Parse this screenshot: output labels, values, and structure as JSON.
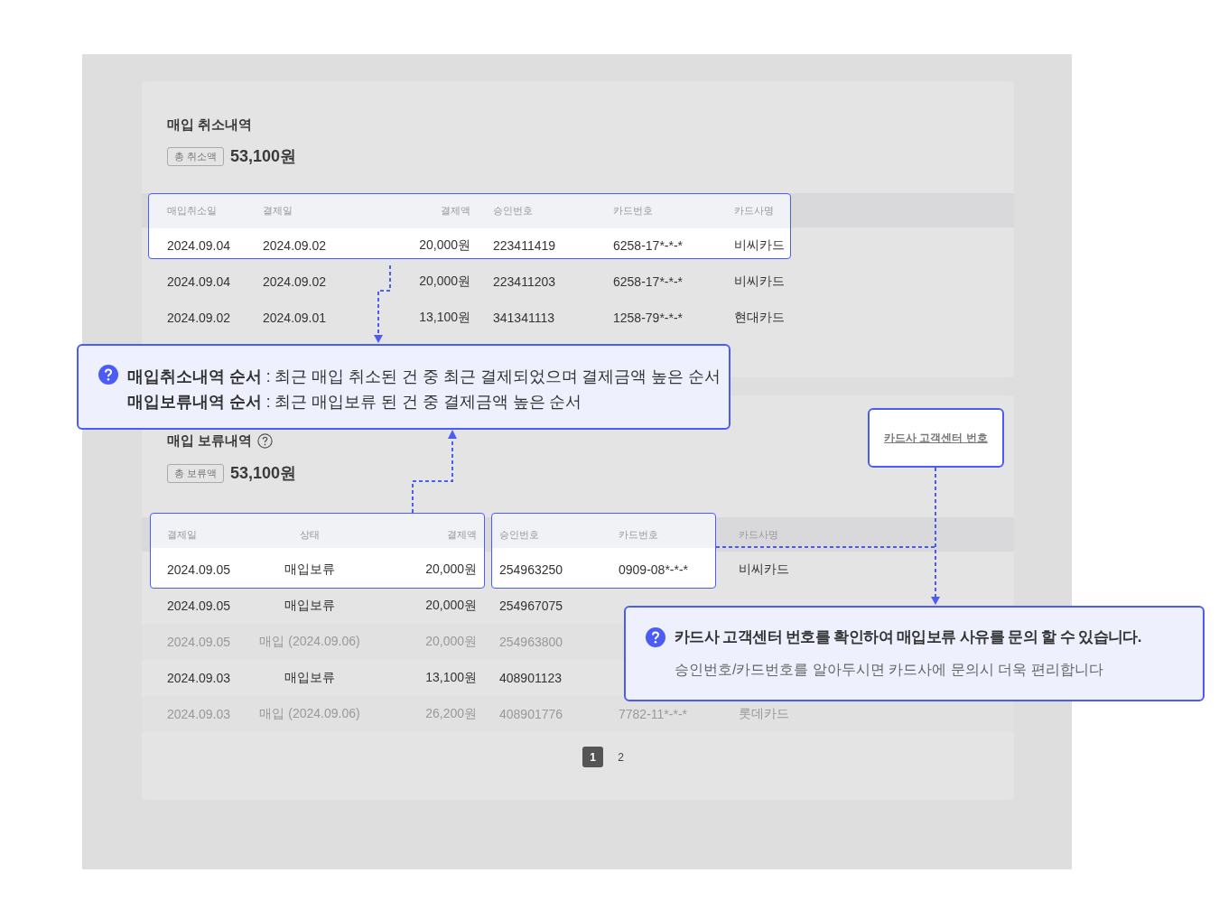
{
  "cancel_section": {
    "title": "매입 취소내역",
    "total_label": "총 취소액",
    "total": "53,100원",
    "columns": [
      "매입취소일",
      "결제일",
      "결제액",
      "승인번호",
      "카드번호",
      "카드사명"
    ],
    "rows": [
      {
        "cells": [
          "2024.09.04",
          "2024.09.02",
          "20,000원",
          "223411419",
          "6258-17*-*-*",
          "비씨카드"
        ]
      },
      {
        "cells": [
          "2024.09.04",
          "2024.09.02",
          "20,000원",
          "223411203",
          "6258-17*-*-*",
          "비씨카드"
        ]
      },
      {
        "cells": [
          "2024.09.02",
          "2024.09.01",
          "13,100원",
          "341341113",
          "1258-79*-*-*",
          "현대카드"
        ]
      }
    ]
  },
  "hold_section": {
    "title": "매입 보류내역",
    "total_label": "총 보류액",
    "total": "53,100원",
    "columns": [
      "결제일",
      "상태",
      "결제액",
      "승인번호",
      "카드번호",
      "카드사명"
    ],
    "rows": [
      {
        "held": true,
        "cells": [
          "2024.09.05",
          "매입보류",
          "20,000원",
          "254963250",
          "0909-08*-*-*",
          "비씨카드"
        ]
      },
      {
        "held": true,
        "cells": [
          "2024.09.05",
          "매입보류",
          "20,000원",
          "254967075"
        ]
      },
      {
        "held": false,
        "cells": [
          "2024.09.05",
          "매입 (2024.09.06)",
          "20,000원",
          "254963800"
        ]
      },
      {
        "held": true,
        "cells": [
          "2024.09.03",
          "매입보류",
          "13,100원",
          "408901123"
        ]
      },
      {
        "held": false,
        "cells": [
          "2024.09.03",
          "매입 (2024.09.06)",
          "26,200원",
          "408901776",
          "7782-11*-*-*",
          "롯데카드"
        ]
      }
    ],
    "pages": [
      {
        "label": "1",
        "selected": true
      },
      {
        "label": "2",
        "selected": false
      }
    ]
  },
  "annotations": {
    "sort_note": [
      "**매입취소내역 순서** : 최근 매입 취소된 건 중 최근 결제되었으며 결제금액 높은 순서",
      "**매입보류내역 순서** : 최근 매입보류 된 건 중 결제금액 높은 순서"
    ],
    "call_center_link": "카드사 고객센터 번호",
    "call_center_note": {
      "title": "카드사 고객센터 번호를 확인하여 매입보류 사유를 문의 할 수 있습니다.",
      "detail": "승인번호/카드번호를 알아두시면 카드사에 문의시 더욱 편리합니다"
    }
  }
}
